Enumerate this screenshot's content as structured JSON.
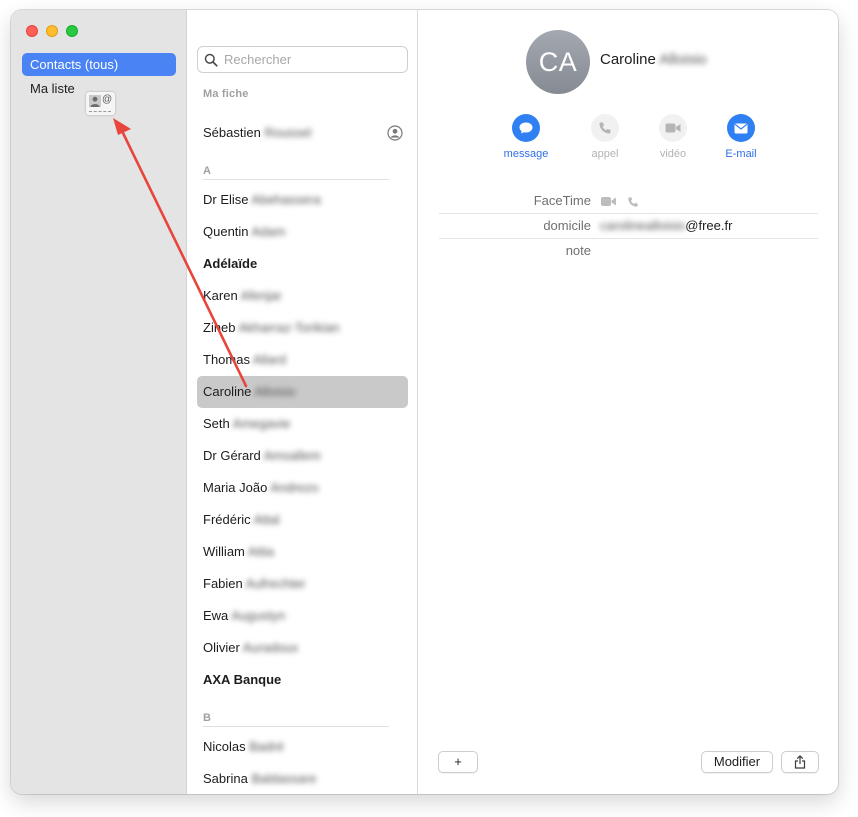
{
  "sidebar": {
    "groups": [
      {
        "label": "Contacts (tous)"
      },
      {
        "label": "Ma liste"
      }
    ],
    "drag_proxy_symbol": "@"
  },
  "search": {
    "placeholder": "Rechercher",
    "icon": "magnifying-glass-icon"
  },
  "list": {
    "my_card_header": "Ma fiche",
    "my_card": {
      "first": "Sébastien",
      "last": "Roussel"
    },
    "section_a": "A",
    "section_b": "B",
    "contacts_a": [
      {
        "first": "Dr Elise",
        "last": "Abehassera"
      },
      {
        "first": "Quentin",
        "last": "Adam"
      },
      {
        "first": "Adélaïde",
        "last": ""
      },
      {
        "first": "Karen",
        "last": "Afenjar"
      },
      {
        "first": "Zineb",
        "last": "Akharraz-Torikian"
      },
      {
        "first": "Thomas",
        "last": "Allard"
      },
      {
        "first": "Caroline",
        "last": "Alloisio"
      },
      {
        "first": "Seth",
        "last": "Amegavie"
      },
      {
        "first": "Dr Gérard",
        "last": "Amsallem"
      },
      {
        "first": "Maria João",
        "last": "Andrezo"
      },
      {
        "first": "Frédéric",
        "last": "Attal"
      },
      {
        "first": "William",
        "last": "Attia"
      },
      {
        "first": "Fabien",
        "last": "Aufrechter"
      },
      {
        "first": "Ewa",
        "last": "Augustyn"
      },
      {
        "first": "Olivier",
        "last": "Auradoux"
      },
      {
        "first": "AXA Banque",
        "last": ""
      }
    ],
    "contacts_b": [
      {
        "first": "Nicolas",
        "last": "Badré"
      },
      {
        "first": "Sabrina",
        "last": "Baldassare"
      }
    ]
  },
  "detail": {
    "initials": "CA",
    "first": "Caroline",
    "last": "Alloisio",
    "actions": {
      "message": "message",
      "call": "appel",
      "video": "vidéo",
      "email": "E-mail"
    },
    "fields": {
      "facetime_label": "FaceTime",
      "home_label": "domicile",
      "home_user": "carolinealloisio",
      "home_domain": "@free.fr",
      "note_label": "note"
    },
    "buttons": {
      "add": "+",
      "edit": "Modifier"
    }
  },
  "colors": {
    "accent": "#4a83f4",
    "action_blue": "#2f80f2",
    "drag_arrow": "#e8453c"
  }
}
